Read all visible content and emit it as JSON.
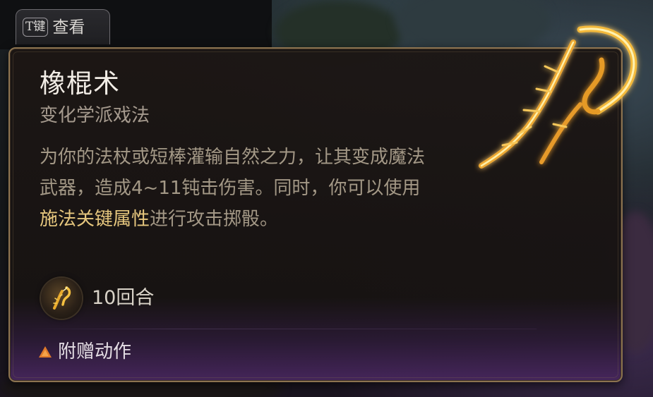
{
  "hotkey_hint": {
    "key": "T键",
    "label": "查看"
  },
  "tooltip": {
    "title": "橡棍术",
    "subtitle": "变化学派戏法",
    "description": {
      "part1": "为你的法杖或短棒灌输自然之力，让其变成魔法武器，造成4~11钝击伤害。同时，你可以使用",
      "highlight": "施法关键属性",
      "part2": "进行攻击掷骰。"
    },
    "duration": {
      "icon": "shillelagh-club-icon",
      "text": "10回合"
    },
    "action": {
      "icon": "bonus-action-triangle-icon",
      "text": "附赠动作"
    }
  },
  "colors": {
    "border": "#8c7350",
    "highlight": "#e6c77e",
    "action_triangle": "#e07a2a",
    "glow": "#f5c040"
  }
}
